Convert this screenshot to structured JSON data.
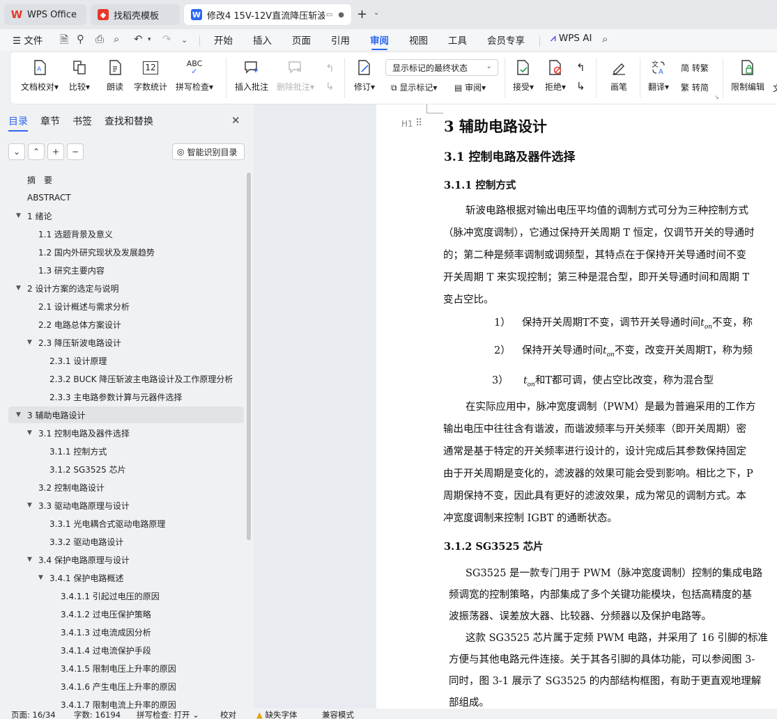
{
  "tabs": [
    {
      "label": "WPS Office",
      "icon": "wps-logo-icon"
    },
    {
      "label": "找稻壳模板",
      "icon": "docer-icon"
    },
    {
      "label": "修改4 15V-12V直流降压斩波E",
      "icon": "word-doc-icon"
    }
  ],
  "menu": {
    "file": "文件",
    "items": [
      "开始",
      "插入",
      "页面",
      "引用",
      "审阅",
      "视图",
      "工具",
      "会员专享"
    ],
    "active": "审阅",
    "ai": "WPS AI"
  },
  "ribbon": {
    "doc_check": "文档校对",
    "compare": "比较",
    "read": "朗读",
    "word_count": "字数统计",
    "spell": "拼写检查",
    "spell_icon_text": "ABC",
    "word_count_icon_text": "12",
    "insert_comment": "插入批注",
    "delete_comment": "删除批注",
    "revise": "修订",
    "display_mode": "显示标记的最终状态",
    "show_markup": "显示标记",
    "review_pane": "审阅",
    "accept": "接受",
    "reject": "拒绝",
    "pen": "画笔",
    "translate": "翻译",
    "to_traditional": "转繁",
    "to_simplified": "转简",
    "restrict_edit": "限制编辑",
    "cut_label": "文"
  },
  "sidebar": {
    "tabs": [
      "目录",
      "章节",
      "书签",
      "查找和替换"
    ],
    "smart_toc": "智能识别目录",
    "toc": [
      {
        "text": "摘　要",
        "level": 0,
        "tri": false
      },
      {
        "text": "ABSTRACT",
        "level": 0,
        "tri": false
      },
      {
        "text": "1  绪论",
        "level": 0,
        "tri": true
      },
      {
        "text": "1.1  选题背景及意义",
        "level": 1,
        "tri": false
      },
      {
        "text": "1.2  国内外研究现状及发展趋势",
        "level": 1,
        "tri": false
      },
      {
        "text": "1.3  研究主要内容",
        "level": 1,
        "tri": false
      },
      {
        "text": "2  设计方案的选定与说明",
        "level": 0,
        "tri": true
      },
      {
        "text": "2.1 设计概述与需求分析",
        "level": 1,
        "tri": false
      },
      {
        "text": "2.2 电路总体方案设计",
        "level": 1,
        "tri": false
      },
      {
        "text": "2.3  降压斩波电路设计",
        "level": 1,
        "tri": true
      },
      {
        "text": "2.3.1  设计原理",
        "level": 2,
        "tri": false
      },
      {
        "text": "2.3.2 BUCK 降压斩波主电路设计及工作原理分析",
        "level": 2,
        "tri": false
      },
      {
        "text": "2.3.3  主电路参数计算与元器件选择",
        "level": 2,
        "tri": false
      },
      {
        "text": "3  辅助电路设计",
        "level": 0,
        "tri": true,
        "selected": true
      },
      {
        "text": "3.1 控制电路及器件选择",
        "level": 1,
        "tri": true
      },
      {
        "text": "3.1.1  控制方式",
        "level": 2,
        "tri": false
      },
      {
        "text": "3.1.2 SG3525 芯片",
        "level": 2,
        "tri": false
      },
      {
        "text": "3.2 控制电路设计",
        "level": 1,
        "tri": false
      },
      {
        "text": "3.3  驱动电路原理与设计",
        "level": 1,
        "tri": true
      },
      {
        "text": "3.3.1  光电耦合式驱动电路原理",
        "level": 2,
        "tri": false
      },
      {
        "text": "3.3.2  驱动电路设计",
        "level": 2,
        "tri": false
      },
      {
        "text": "3.4 保护电路原理与设计",
        "level": 1,
        "tri": true
      },
      {
        "text": "3.4.1 保护电路概述",
        "level": 2,
        "tri": true
      },
      {
        "text": "3.4.1.1  引起过电压的原因",
        "level": 3,
        "tri": false
      },
      {
        "text": "3.4.1.2  过电压保护策略",
        "level": 3,
        "tri": false
      },
      {
        "text": "3.4.1.3  过电流成因分析",
        "level": 3,
        "tri": false
      },
      {
        "text": "3.4.1.4  过电流保护手段",
        "level": 3,
        "tri": false
      },
      {
        "text": "3.4.1.5  限制电压上升率的原因",
        "level": 3,
        "tri": false
      },
      {
        "text": "3.4.1.6  产生电压上升率的原因",
        "level": 3,
        "tri": false
      },
      {
        "text": "3.4.1.7  限制电流上升率的原因",
        "level": 3,
        "tri": false
      }
    ]
  },
  "doc": {
    "heading_marker": "H1",
    "h1": "3  辅助电路设计",
    "h2": "3.1 控制电路及器件选择",
    "h3a": "3.1.1  控制方式",
    "para1": [
      "斩波电路根据对输出电压平均值的调制方式可分为三种控制方式",
      "（脉冲宽度调制），它通过保持开关周期 T 恒定，仅调节开关的导通时",
      "的；第二种是频率调制或调频型，其特点在于保持开关导通时间不变",
      "开关周期 T 来实现控制；第三种是混合型，即开关导通时间和周期 T",
      "变占空比。"
    ],
    "ton_base": "t",
    "ton_sub": "on",
    "list1_num": "1）",
    "list1_pre": "保持开关周期T不变，调节开关导通时间",
    "list1_post": "不变，称",
    "list2_num": "2）",
    "list2_pre": "保持开关导通时间",
    "list2_post": "不变，改变开关周期T，称为频",
    "list3_num": "3）",
    "list3_post": "和T都可调，使占空比改变，称为混合型",
    "para2": [
      "在实际应用中，脉冲宽度调制（PWM）是最为普遍采用的工作方",
      "输出电压中往往含有谐波，而谐波频率与开关频率（即开关周期）密",
      "通常是基于特定的开关频率进行设计的，设计完成后其参数保持固定",
      "由于开关周期是变化的，滤波器的效果可能会受到影响。相比之下，P",
      "周期保持不变，因此具有更好的滤波效果，成为常见的调制方式。本",
      "冲宽度调制来控制 IGBT 的通断状态。"
    ],
    "h3b": "3.1.2 SG3525 芯片",
    "para3": [
      "SG3525 是一款专门用于 PWM（脉冲宽度调制）控制的集成电路",
      "频调宽的控制策略，内部集成了多个关键功能模块，包括高精度的基",
      "波振荡器、误差放大器、比较器、分频器以及保护电路等。"
    ],
    "para4": [
      "这款 SG3525 芯片属于定频 PWM 电路，并采用了 16 引脚的标准",
      "方便与其他电路元件连接。关于其各引脚的具体功能，可以参阅图 3-",
      "同时，图 3-1 展示了 SG3525 的内部结构框图，有助于更直观地理解",
      "部组成。"
    ]
  },
  "status": {
    "page": "页面: 16/34",
    "words": "字数: 16194",
    "spell": "拼写检查: 打开",
    "proof": "校对",
    "missing_font": "缺失字体",
    "compat": "兼容模式"
  }
}
